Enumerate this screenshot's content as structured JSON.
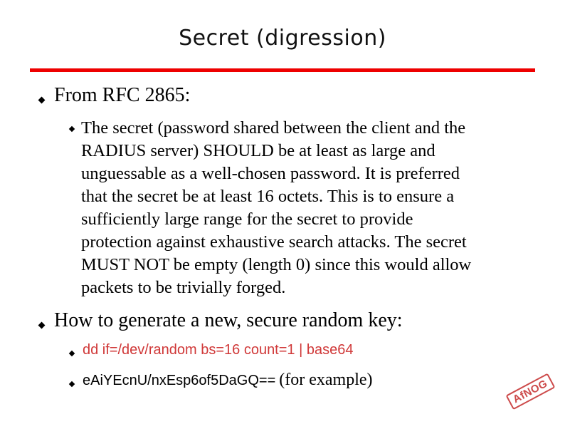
{
  "slide": {
    "title": "Secret (digression)",
    "colors": {
      "rule": "#ee0000",
      "command": "#d03838",
      "stamp": "#c83838"
    },
    "bullets": [
      {
        "text": "From RFC 2865:",
        "sub": [
          {
            "lines": [
              "The secret (password shared between the client and the",
              "RADIUS server) SHOULD be at least as large and",
              "unguessable as a well-chosen password.  It is preferred",
              "that the secret be at least 16 octets.  This is to ensure a",
              "sufficiently large range for the secret to provide",
              "protection against exhaustive search attacks. The secret",
              "MUST NOT be empty (length 0) since this would allow",
              "packets to be trivially forged."
            ]
          }
        ]
      },
      {
        "text": "How to generate a new, secure random key:",
        "sub": [
          {
            "command": "dd if=/dev/random bs=16 count=1 | base64"
          },
          {
            "key": "eAiYEcnU/nxEsp6of5DaGQ==",
            "note": "(for example)"
          }
        ]
      }
    ],
    "stamp": "AfNOG"
  }
}
